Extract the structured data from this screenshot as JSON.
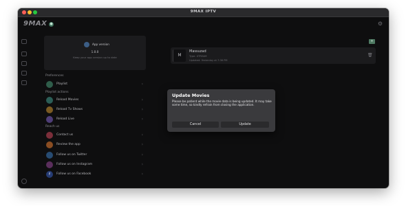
{
  "window": {
    "title": "9MAX IPTV"
  },
  "app": {
    "logo": "9MAX",
    "badge_icon": "shield-icon"
  },
  "app_info": {
    "version_label": "App version",
    "version": "1.0.0",
    "keep_updated": "Keep your app version up to date"
  },
  "sections": {
    "preferences": "Preferences",
    "playlist_actions": "Playlist actions",
    "reach_us": "Reach us"
  },
  "menu": {
    "playlist": {
      "label": "Playlist",
      "color": "#2f5d4a"
    },
    "reload_movies": {
      "label": "Reload Movies",
      "color": "#2b5e57"
    },
    "reload_tv_shows": {
      "label": "Reload Tv Shows",
      "color": "#7a5a22"
    },
    "reload_live": {
      "label": "Reload Live",
      "color": "#4e3d77"
    },
    "contact_us": {
      "label": "Contact us",
      "color": "#7b2e3a"
    },
    "review_app": {
      "label": "Review the app",
      "color": "#8a4d22"
    },
    "twitter": {
      "label": "Follow us on Twitter",
      "color": "#274b72"
    },
    "instagram": {
      "label": "Follow us on Instagram",
      "color": "#5a2e5c"
    },
    "facebook": {
      "label": "Follow us on Facebook",
      "color": "#253b73",
      "glyph": "f"
    }
  },
  "playlist_card": {
    "avatar": "M",
    "title": "Massuzad",
    "type": "Type: XTREAM",
    "updated": "Updated: Yesterday at 7:36 PM"
  },
  "dialog": {
    "title": "Update Movies",
    "body": "Please be patient while the movie data is being updated. It may take some time, so kindly refrain from closing the application.",
    "cancel": "Cancel",
    "update": "Update"
  }
}
